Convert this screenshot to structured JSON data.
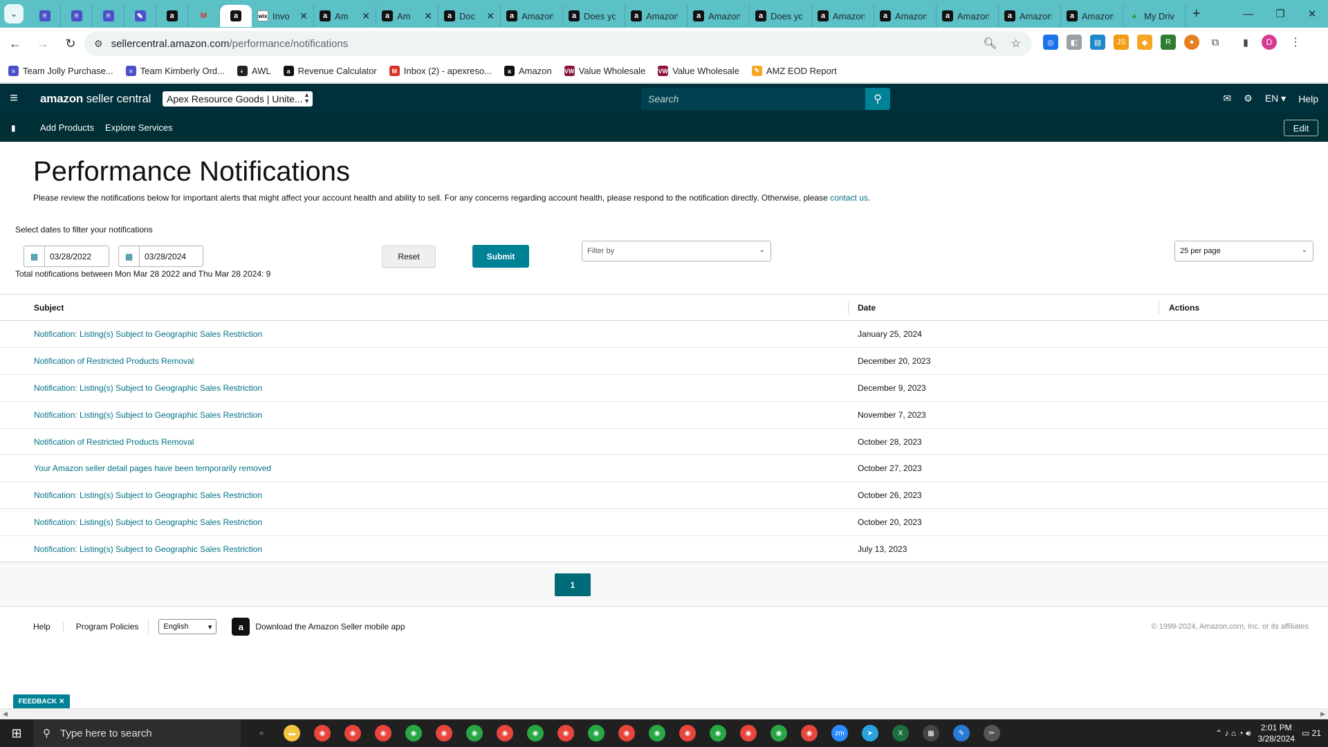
{
  "browser": {
    "tabs": [
      {
        "label": "",
        "icon": "docs",
        "pinned": true
      },
      {
        "label": "",
        "icon": "docs",
        "pinned": true
      },
      {
        "label": "",
        "icon": "docs",
        "pinned": true
      },
      {
        "label": "",
        "icon": "pen",
        "pinned": true
      },
      {
        "label": "",
        "icon": "amazon",
        "pinned": true
      },
      {
        "label": "",
        "icon": "gmail",
        "pinned": true
      },
      {
        "label": "",
        "icon": "amazon",
        "pinned": true,
        "active": true
      },
      {
        "label": "Invo",
        "icon": "wix",
        "close": true
      },
      {
        "label": "Am",
        "icon": "amazon",
        "close": true
      },
      {
        "label": "Am",
        "icon": "amazon",
        "close": true
      },
      {
        "label": "Doc",
        "icon": "amazon",
        "close": true
      },
      {
        "label": "Amazon",
        "icon": "amazon"
      },
      {
        "label": "Does yo",
        "icon": "amazon"
      },
      {
        "label": "Amazon",
        "icon": "amazon"
      },
      {
        "label": "Amazon",
        "icon": "amazon"
      },
      {
        "label": "Does yo",
        "icon": "amazon"
      },
      {
        "label": "Amazon",
        "icon": "amazon"
      },
      {
        "label": "Amazon",
        "icon": "amazon"
      },
      {
        "label": "Amazon",
        "icon": "amazon"
      },
      {
        "label": "Amazon",
        "icon": "amazon"
      },
      {
        "label": "Amazon",
        "icon": "amazon"
      },
      {
        "label": "My Driv",
        "icon": "gdrive"
      }
    ],
    "url_host": "sellercentral.amazon.com",
    "url_path": "/performance/notifications",
    "bookmarks": [
      {
        "label": "Team Jolly Purchase...",
        "color": "#4b4fc9",
        "glyph": "≡"
      },
      {
        "label": "Team Kimberly Ord...",
        "color": "#4b4fc9",
        "glyph": "≡"
      },
      {
        "label": "AWL",
        "color": "#222222",
        "glyph": "◐"
      },
      {
        "label": "Revenue Calculator",
        "color": "#111111",
        "glyph": "a"
      },
      {
        "label": "Inbox (2) - apexreso...",
        "color": "#d93025",
        "glyph": "M"
      },
      {
        "label": "Amazon",
        "color": "#111111",
        "glyph": "a"
      },
      {
        "label": "Value Wholesale",
        "color": "#8b1538",
        "glyph": "VW"
      },
      {
        "label": "Value Wholesale",
        "color": "#8b1538",
        "glyph": "VW"
      },
      {
        "label": "AMZ EOD Report",
        "color": "#f5a623",
        "glyph": "✎"
      }
    ],
    "profile_initial": "D"
  },
  "header": {
    "logo_bold": "amazon",
    "logo_rest": " seller central",
    "store": "Apex Resource Goods | Unite...",
    "search_placeholder": "Search",
    "language": "EN",
    "help": "Help"
  },
  "subnav": {
    "links": [
      "Add Products",
      "Explore Services"
    ],
    "edit": "Edit"
  },
  "page": {
    "title": "Performance Notifications",
    "description": "Please review the notifications below for important alerts that might affect your account health and ability to sell. For any concerns regarding account health, please respond to the notification directly. Otherwise, please ",
    "contact_link": "contact us",
    "description_end": ".",
    "filter_label": "Select dates to filter your notifications",
    "start_date": "03/28/2022",
    "end_date": "03/28/2024",
    "total_line": "Total notifications between Mon Mar 28 2022 and Thu Mar 28 2024: 9",
    "reset": "Reset",
    "submit": "Submit",
    "filter_by": "Filter by",
    "per_page": "25 per page"
  },
  "table": {
    "headers": {
      "subject": "Subject",
      "date": "Date",
      "actions": "Actions"
    },
    "rows": [
      {
        "subject": "Notification: Listing(s) Subject to Geographic Sales Restriction",
        "date": "January 25, 2024"
      },
      {
        "subject": "Notification of Restricted Products Removal",
        "date": "December 20, 2023"
      },
      {
        "subject": "Notification: Listing(s) Subject to Geographic Sales Restriction",
        "date": "December 9, 2023"
      },
      {
        "subject": "Notification: Listing(s) Subject to Geographic Sales Restriction",
        "date": "November 7, 2023"
      },
      {
        "subject": "Notification of Restricted Products Removal",
        "date": "October 28, 2023"
      },
      {
        "subject": "Your Amazon seller detail pages have been temporarily removed",
        "date": "October 27, 2023"
      },
      {
        "subject": "Notification: Listing(s) Subject to Geographic Sales Restriction",
        "date": "October 26, 2023"
      },
      {
        "subject": "Notification: Listing(s) Subject to Geographic Sales Restriction",
        "date": "October 20, 2023"
      },
      {
        "subject": "Notification: Listing(s) Subject to Geographic Sales Restriction",
        "date": "July 13, 2023"
      }
    ]
  },
  "pagination": {
    "current": "1"
  },
  "footer": {
    "help": "Help",
    "policies": "Program Policies",
    "language": "English",
    "app_text": "Download the Amazon Seller mobile app",
    "copyright": "© 1999-2024, Amazon.com, Inc. or its affiliates"
  },
  "feedback": "FEEDBACK",
  "taskbar": {
    "search_placeholder": "Type here to search",
    "time": "2:01 PM",
    "date": "3/28/2024",
    "notif_count": "21"
  }
}
